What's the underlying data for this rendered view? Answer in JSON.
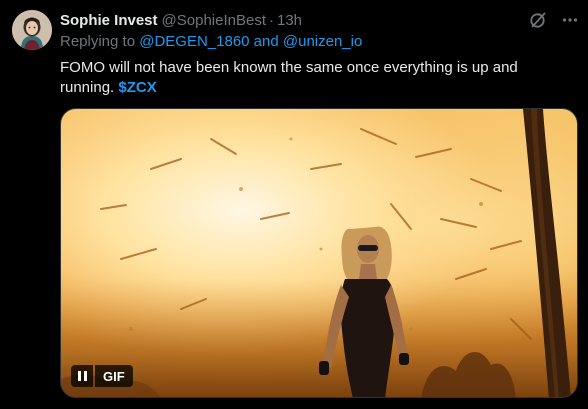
{
  "author": {
    "display_name": "Sophie Invest",
    "handle": "@SophieInBest",
    "separator": "·",
    "time": "13h"
  },
  "reply": {
    "prefix": "Replying to",
    "mention_1": "@DEGEN_1860",
    "conjunction": "and",
    "mention_2": "@unizen_io"
  },
  "tweet": {
    "text": "FOMO will not have been known the same once everything is up and running.",
    "cashtag": "$ZCX"
  },
  "media": {
    "type_badge": "GIF",
    "state": "playing"
  },
  "icons": {
    "grok": "grok-icon",
    "more": "more-icon",
    "pause": "pause-icon"
  },
  "colors": {
    "background": "#000000",
    "text": "#e7e9ea",
    "secondary": "#71767b",
    "accent": "#1d9bf0"
  }
}
